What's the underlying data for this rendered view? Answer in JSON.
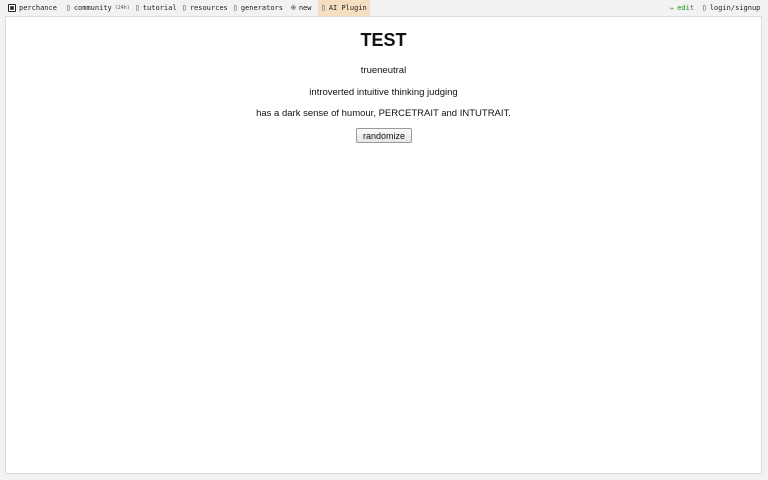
{
  "nav": {
    "brand": "perchance",
    "community": "community",
    "community_badge": "(24h)",
    "tutorial": "tutorial",
    "resources": "resources",
    "generators": "generators",
    "new": "new",
    "ai_plugin": "AI Plugin",
    "edit": "edit",
    "login": "login/signup"
  },
  "icons": {
    "brand": "dice-icon",
    "community": "chat-icon",
    "tutorial": "book-icon",
    "resources": "box-icon",
    "generators": "list-icon",
    "new": "plus-circle-icon",
    "ai_plugin": "plugin-icon",
    "edit": "pencil-icon",
    "login": "user-icon"
  },
  "page": {
    "title": "TEST",
    "line1": "trueneutral",
    "line2": "introverted intuitive thinking judging",
    "line3": "has a dark sense of humour, PERCETRAIT and INTUTRAIT.",
    "randomize_label": "randomize"
  },
  "colors": {
    "ai_plugin_bg": "#f6dfc1",
    "edit_color": "#2e8b2e"
  }
}
